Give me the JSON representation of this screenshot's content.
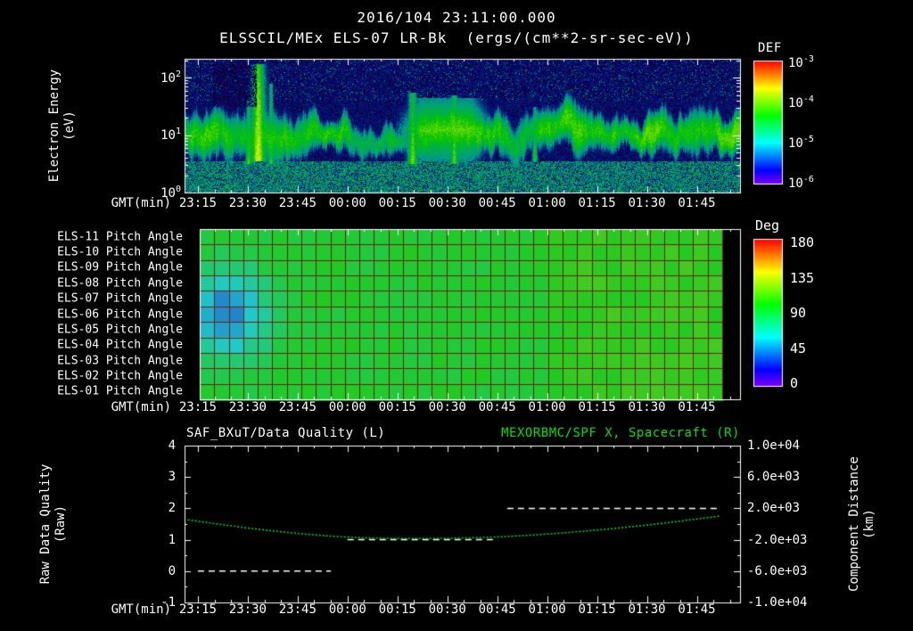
{
  "colors": {
    "background": "#000000",
    "foreground": "#ffffff",
    "accent_green": "#00e000",
    "grid_red": "#6e2012"
  },
  "header": {
    "timestamp": "2016/104 23:11:00.000",
    "instrument_title": "ELSSCIL/MEx ELS-07 LR-Bk",
    "units_label": "(ergs/(cm**2-sr-sec-eV))"
  },
  "time_axis": {
    "label": "GMT(min)",
    "ticks": [
      "23:15",
      "23:30",
      "23:45",
      "00:00",
      "00:15",
      "00:30",
      "00:45",
      "01:00",
      "01:15",
      "01:30",
      "01:45"
    ]
  },
  "spectrogram_panel": {
    "ylabel_line1": "Electron Energy",
    "ylabel_line2": "(eV)",
    "y_tick_exponents": [
      "2",
      "1",
      "0"
    ],
    "colorbar": {
      "title": "DEF",
      "tick_exponents": [
        "-3",
        "-4",
        "-5",
        "-6"
      ]
    }
  },
  "pitch_panel": {
    "row_labels": [
      "ELS-11 Pitch Angle",
      "ELS-10 Pitch Angle",
      "ELS-09 Pitch Angle",
      "ELS-08 Pitch Angle",
      "ELS-07 Pitch Angle",
      "ELS-06 Pitch Angle",
      "ELS-05 Pitch Angle",
      "ELS-04 Pitch Angle",
      "ELS-03 Pitch Angle",
      "ELS-02 Pitch Angle",
      "ELS-01 Pitch Angle"
    ],
    "colorbar": {
      "title": "Deg",
      "ticks": [
        "180",
        "135",
        "90",
        "45",
        "0"
      ]
    }
  },
  "line_panel": {
    "title_left": "SAF_BXuT/Data Quality (L)",
    "title_right": "MEXORBMC/SPF X, Spacecraft (R)",
    "ylabel_left_line1": "Raw Data Quality",
    "ylabel_left_line2": "(Raw)",
    "ylabel_right_line1": "Component Distance",
    "ylabel_right_line2": "(km)",
    "left_ticks": [
      "4",
      "3",
      "2",
      "1",
      "0",
      "-1"
    ],
    "right_ticks": [
      "1.0e+04",
      "6.0e+03",
      "2.0e+03",
      "-2.0e+03",
      "-6.0e+03",
      "-1.0e+04"
    ]
  },
  "chart_data": [
    {
      "id": "electron-energy-spectrogram",
      "type": "heatmap",
      "title": "ELSSCIL/MEx ELS-07 LR-Bk",
      "units": "ergs/(cm**2-sr-sec-eV)",
      "x_start_min": 1391,
      "x_end_min": 1558,
      "x_tick_minutes": [
        1395,
        1410,
        1425,
        1440,
        1455,
        1470,
        1485,
        1500,
        1515,
        1530,
        1545
      ],
      "y_scale": "log",
      "y_range_eV": [
        1,
        215
      ],
      "value_scale": "log10",
      "value_range": [
        -6,
        -3
      ],
      "colorbar_label": "DEF",
      "background_level": -5.65,
      "low_energy_level": -4.95,
      "band": {
        "center_log_eV": 1.05,
        "width_log": 0.3,
        "peak_level": -4.35
      },
      "features": [
        {
          "type": "burst",
          "t_frac": 0.132,
          "width_frac": 0.012,
          "log_eV_range": [
            0.55,
            2.25
          ],
          "level": -3.7
        },
        {
          "type": "burst",
          "t_frac": 0.115,
          "width_frac": 0.006,
          "log_eV_range": [
            0.5,
            1.6
          ],
          "level": -4.15
        },
        {
          "type": "burst",
          "t_frac": 0.155,
          "width_frac": 0.005,
          "log_eV_range": [
            0.5,
            1.9
          ],
          "level": -4.2
        },
        {
          "type": "enhancement",
          "t_frac_range": [
            0.38,
            0.56
          ],
          "log_eV_range": [
            0.55,
            1.65
          ],
          "level": -4.1
        },
        {
          "type": "burst",
          "t_frac": 0.41,
          "width_frac": 0.009,
          "log_eV_range": [
            0.5,
            1.75
          ],
          "level": -4.0
        },
        {
          "type": "burst",
          "t_frac": 0.485,
          "width_frac": 0.007,
          "log_eV_range": [
            0.5,
            1.7
          ],
          "level": -4.05
        },
        {
          "type": "burst",
          "t_frac": 0.63,
          "width_frac": 0.005,
          "log_eV_range": [
            0.55,
            1.5
          ],
          "level": -4.25
        },
        {
          "type": "dark_patch",
          "t_frac_range": [
            0.05,
            0.13
          ],
          "log_eV_range": [
            1.5,
            2.25
          ],
          "level": -6.0
        }
      ]
    },
    {
      "id": "pitch-angle-grid",
      "type": "heatmap",
      "rows": 11,
      "value_units": "deg",
      "value_range": [
        0,
        180
      ],
      "colorbar_label": "Deg",
      "x_start_min": 1395,
      "x_end_min": 1552,
      "base_value_deg": 96,
      "right_region": {
        "t_frac_start": 0.62,
        "value_deg": 104
      },
      "blue_patch": {
        "t_frac_center": 0.04,
        "t_frac_width": 0.075,
        "row_center": 5,
        "row_width": 2.8,
        "depth_deg": 55
      }
    },
    {
      "id": "quality-and-distance",
      "type": "line",
      "left_axis": {
        "label": "Raw Data Quality (Raw)",
        "range": [
          -1,
          4
        ]
      },
      "right_axis": {
        "label": "Component Distance (km)",
        "range": [
          -10000,
          10000
        ]
      },
      "series": [
        {
          "name": "SAF_BXuT/Data Quality (L)",
          "axis": "left",
          "color": "#ffffff",
          "style": "dashed-steps",
          "points": [
            [
              1395,
              0
            ],
            [
              1435,
              0
            ],
            [
              1440,
              1
            ],
            [
              1485,
              1
            ],
            [
              1488,
              2
            ],
            [
              1552,
              2
            ]
          ]
        },
        {
          "name": "MEXORBMC/SPF X, Spacecraft (R)",
          "axis": "right",
          "color": "#00dd33",
          "style": "dotted",
          "points": [
            [
              1392,
              550
            ],
            [
              1398,
              180
            ],
            [
              1404,
              -170
            ],
            [
              1410,
              -500
            ],
            [
              1416,
              -800
            ],
            [
              1422,
              -1070
            ],
            [
              1428,
              -1310
            ],
            [
              1434,
              -1510
            ],
            [
              1440,
              -1660
            ],
            [
              1446,
              -1770
            ],
            [
              1452,
              -1830
            ],
            [
              1458,
              -1850
            ],
            [
              1464,
              -1845
            ],
            [
              1470,
              -1820
            ],
            [
              1476,
              -1770
            ],
            [
              1482,
              -1690
            ],
            [
              1488,
              -1580
            ],
            [
              1494,
              -1440
            ],
            [
              1500,
              -1280
            ],
            [
              1506,
              -1090
            ],
            [
              1512,
              -880
            ],
            [
              1518,
              -650
            ],
            [
              1524,
              -400
            ],
            [
              1530,
              -130
            ],
            [
              1536,
              160
            ],
            [
              1542,
              470
            ],
            [
              1548,
              800
            ],
            [
              1552,
              1030
            ]
          ]
        }
      ]
    }
  ]
}
